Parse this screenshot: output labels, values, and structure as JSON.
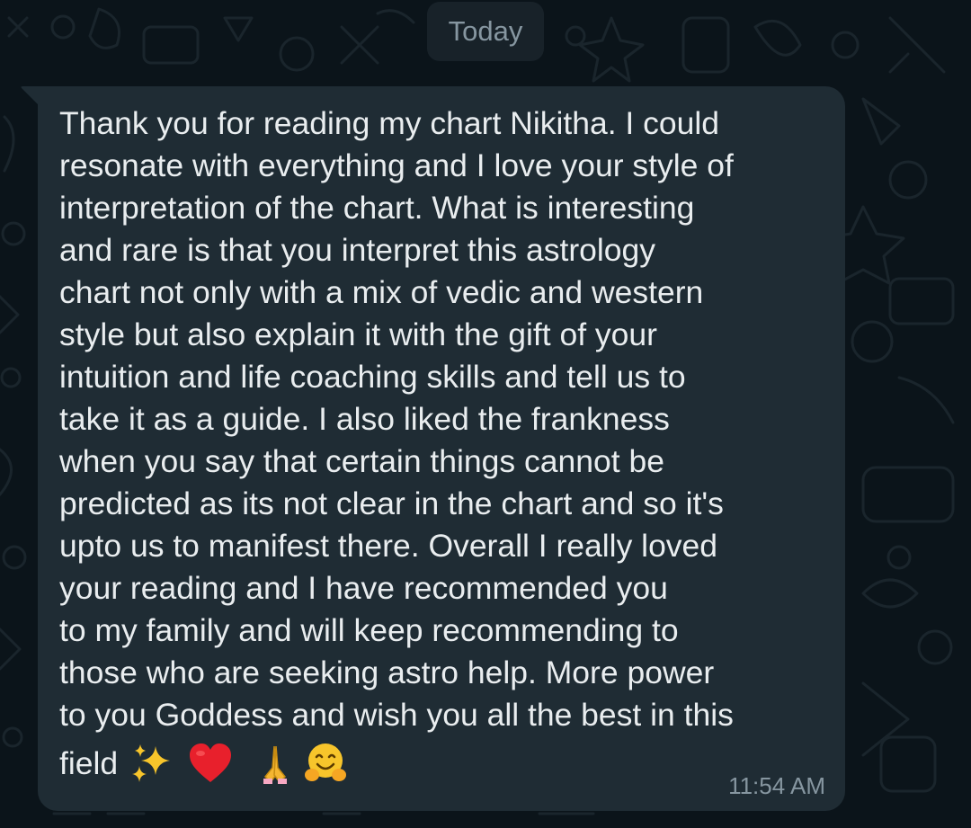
{
  "chat": {
    "date_label": "Today",
    "message": {
      "text": "Thank you for reading my chart Nikitha. I could\nresonate with everything and I love your style of\ninterpretation of the chart. What is interesting\nand rare is that you interpret this astrology\nchart not only with a mix of vedic and western\nstyle but also explain it with the gift of your\nintuition and life coaching skills and tell us to\ntake it as a guide. I also liked the frankness\nwhen you say that certain things cannot be\npredicted as its not clear in the chart and so it's\nupto us to manifest there. Overall I really loved\nyour reading and I have recommended you\nto my family and will keep recommending to\nthose who are seeking astro help. More power\nto you Goddess and wish you all the best in this",
      "last_line": "field",
      "emojis": [
        "sparkles-icon",
        "red-heart-icon",
        "folded-hands-icon",
        "hugging-face-icon"
      ],
      "time": "11:54 AM"
    }
  },
  "colors": {
    "background": "#0b141a",
    "bubble": "#1f2c34",
    "text": "#e9edef",
    "meta_text": "#8696a0",
    "date_chip": "#182229"
  }
}
